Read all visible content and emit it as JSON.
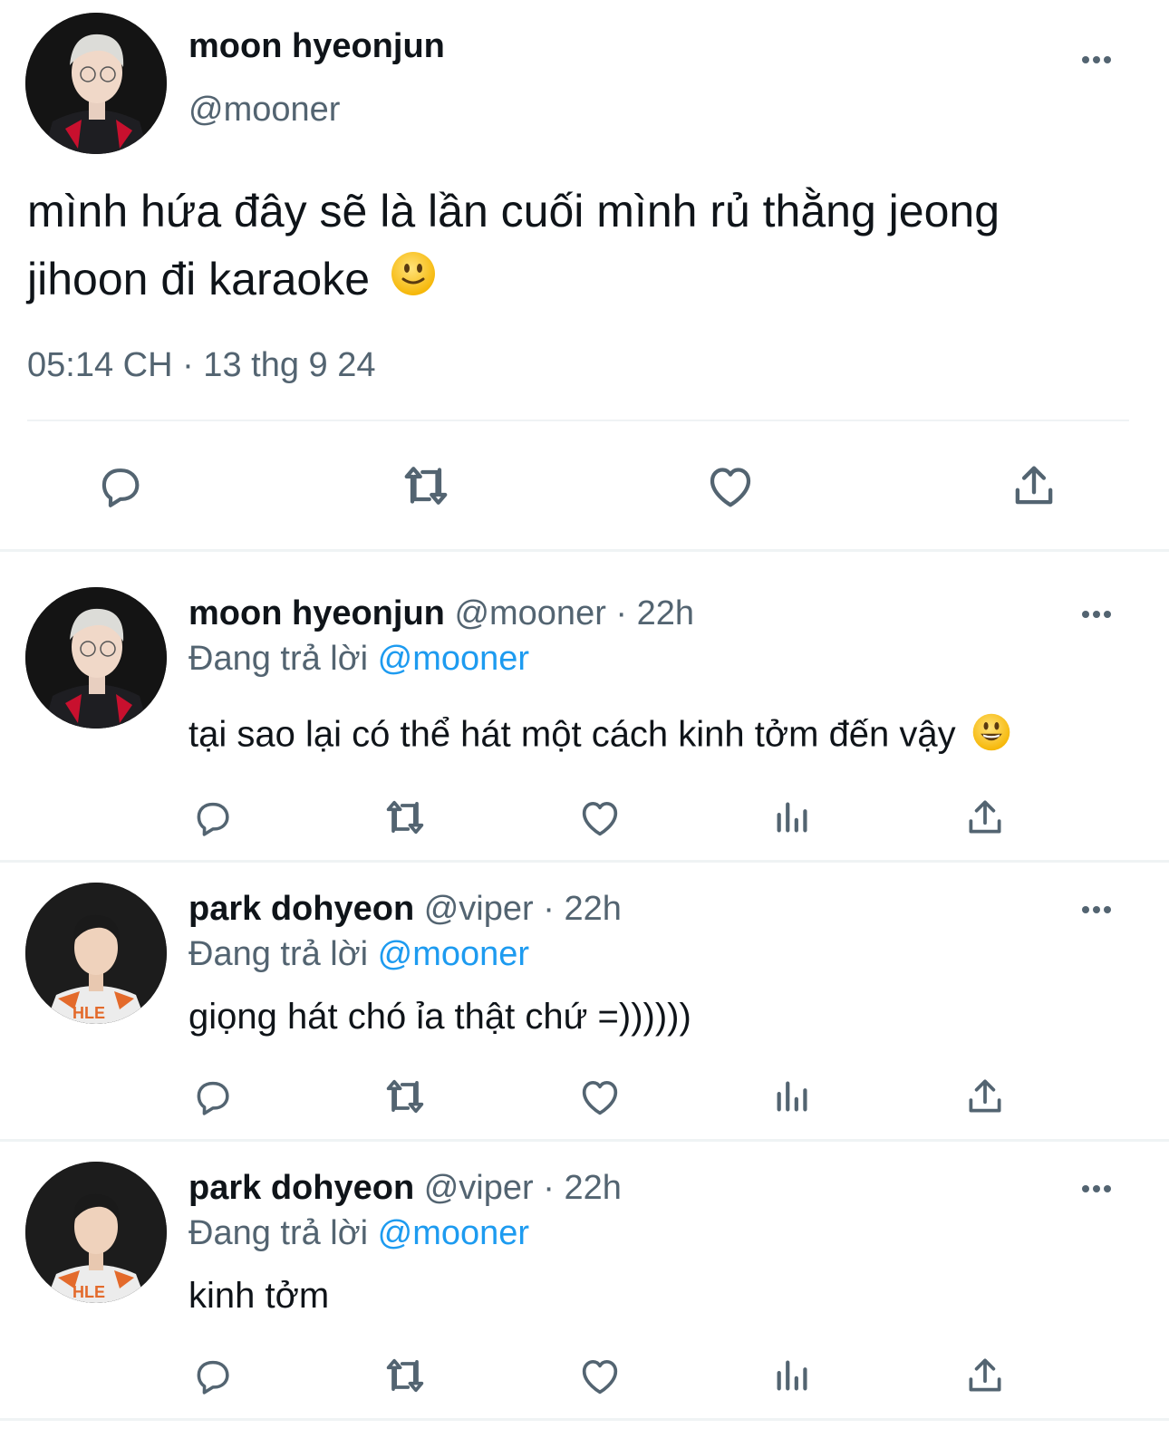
{
  "main_tweet": {
    "author_name": "moon hyeonjun",
    "author_handle": "@mooner",
    "text": "mình hứa đây sẽ là lần cuối mình rủ thằng jeong jihoon đi karaoke",
    "text_line1": "mình hứa đây sẽ là lần cuối mình rủ thằng jeong",
    "text_line2": "jihoon đi karaoke",
    "emoji": "slightly-smiling-face",
    "timestamp": "05:14 CH · 13 thg 9 24",
    "more_icon": "more-horizontal-icon",
    "actions": [
      "reply-icon",
      "retweet-icon",
      "like-icon",
      "share-icon"
    ]
  },
  "replies": [
    {
      "author_name": "moon hyeonjun",
      "author_handle": "@mooner",
      "separator": "·",
      "time": "22h",
      "replying_prefix": "Đang trả lời",
      "replying_to": "@mooner",
      "text": "tại sao lại có thể hát một cách kinh tởm đến vậy",
      "emoji": "grinning-face"
    },
    {
      "author_name": "park dohyeon",
      "author_handle": "@viper",
      "separator": "·",
      "time": "22h",
      "replying_prefix": "Đang trả lời",
      "replying_to": "@mooner",
      "text": "giọng hát chó ỉa thật chứ =))))))",
      "jersey_text": "HLE"
    },
    {
      "author_name": "park dohyeon",
      "author_handle": "@viper",
      "separator": "·",
      "time": "22h",
      "replying_prefix": "Đang trả lời",
      "replying_to": "@mooner",
      "text": "kinh tởm",
      "jersey_text": "HLE"
    }
  ],
  "reply_actions": [
    "reply-icon",
    "retweet-icon",
    "like-icon",
    "views-icon",
    "share-icon"
  ],
  "colors": {
    "text": "#0f1419",
    "secondary": "#536471",
    "link": "#1d9bf0",
    "divider": "#eff3f4",
    "background": "#ffffff"
  }
}
